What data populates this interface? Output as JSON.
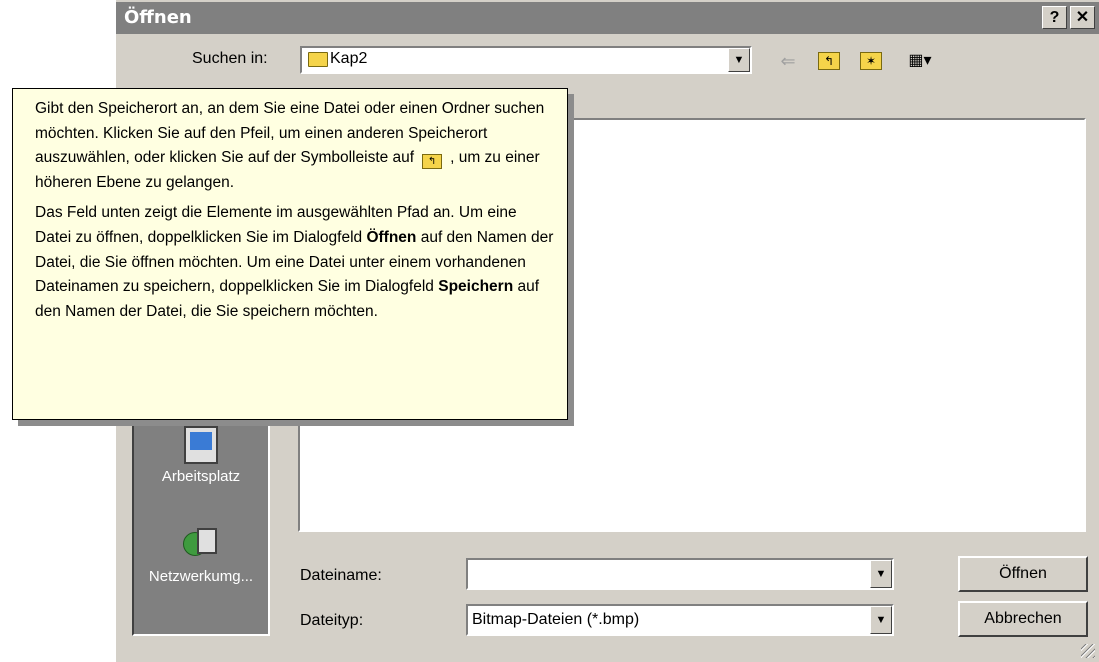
{
  "dialog": {
    "title": "Öffnen",
    "help_btn": "?",
    "close_btn": "✕"
  },
  "lookin": {
    "label": "Suchen in:",
    "value": "Kap2"
  },
  "toolbar": {
    "back_icon": "back-arrow-icon",
    "up_icon": "up-one-level-icon",
    "new_folder_icon": "new-folder-icon",
    "view_icon": "view-menu-icon"
  },
  "places": {
    "arbeitsplatz": "Arbeitsplatz",
    "netzwerk": "Netzwerkumg..."
  },
  "filename": {
    "label": "Dateiname:",
    "value": ""
  },
  "filetype": {
    "label": "Dateityp:",
    "value": "Bitmap-Dateien (*.bmp)"
  },
  "buttons": {
    "open": "Öffnen",
    "cancel": "Abbrechen"
  },
  "tooltip": {
    "p1_a": "Gibt den Speicherort an, an dem Sie eine Datei oder einen Ordner suchen möchten. Klicken Sie auf den Pfeil, um einen anderen Speicherort auszuwählen, oder klicken Sie auf der Symbolleiste auf",
    "p1_b": ", um zu einer höheren Ebene zu gelangen.",
    "p2_a": "Das Feld unten zeigt die Elemente im ausgewählten Pfad an. Um eine Datei zu öffnen, doppelklicken Sie im Dialogfeld",
    "p2_bold1": "Öffnen",
    "p2_b": "auf den Namen der Datei, die Sie öffnen möchten. Um eine Datei unter einem vorhandenen Dateinamen zu speichern, doppelklicken Sie im Dialogfeld",
    "p2_bold2": "Speichern",
    "p2_c": "auf den Namen der Datei, die Sie speichern möchten."
  }
}
